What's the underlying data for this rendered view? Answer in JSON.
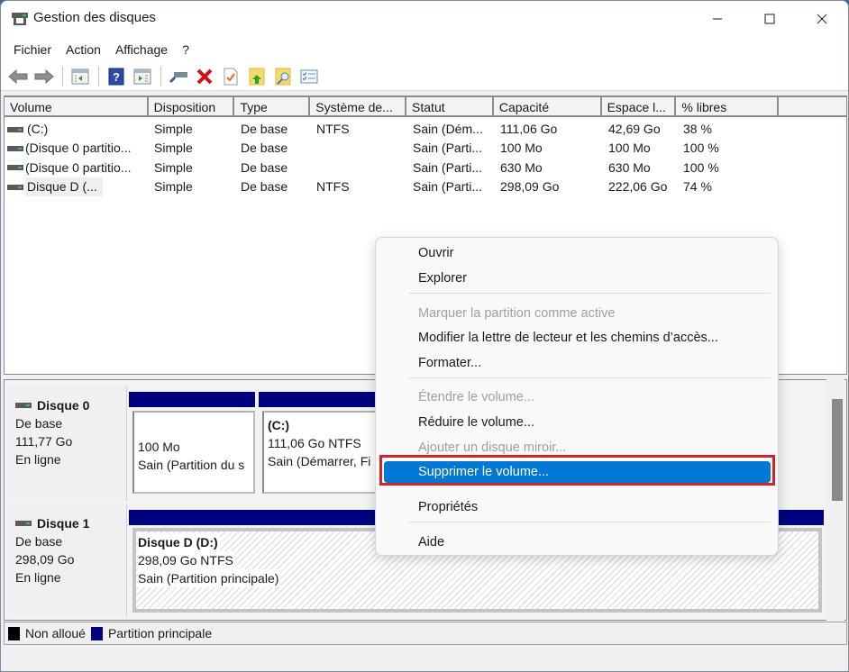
{
  "window": {
    "title": "Gestion des disques",
    "controls": [
      "minimize",
      "maximize",
      "close"
    ]
  },
  "menubar": {
    "items": [
      "Fichier",
      "Action",
      "Affichage",
      "?"
    ]
  },
  "toolbar": {
    "buttons": [
      "back-arrow-icon",
      "forward-arrow-icon",
      "show-hide-console-tree-icon",
      "help-icon",
      "show-hide-action-pane-icon",
      "connect-drive-icon",
      "delete-icon",
      "check-properties-icon",
      "folder-up-icon",
      "folder-search-icon",
      "list-settings-icon"
    ]
  },
  "volume_list": {
    "columns": [
      "Volume",
      "Disposition",
      "Type",
      "Système de...",
      "Statut",
      "Capacité",
      "Espace l...",
      "% libres"
    ],
    "rows": [
      {
        "volume": " (C:)",
        "disposition": "Simple",
        "type": "De base",
        "fs": "NTFS",
        "status": "Sain (Dém...",
        "capacity": "111,06 Go",
        "free": "42,69 Go",
        "pct": "38 %"
      },
      {
        "volume": "(Disque 0 partitio...",
        "disposition": "Simple",
        "type": "De base",
        "fs": "",
        "status": "Sain (Parti...",
        "capacity": "100 Mo",
        "free": "100 Mo",
        "pct": "100 %"
      },
      {
        "volume": "(Disque 0 partitio...",
        "disposition": "Simple",
        "type": "De base",
        "fs": "",
        "status": "Sain (Parti...",
        "capacity": "630 Mo",
        "free": "630 Mo",
        "pct": "100 %"
      },
      {
        "volume": "Disque D (...",
        "disposition": "Simple",
        "type": "De base",
        "fs": "NTFS",
        "status": "Sain (Parti...",
        "capacity": "298,09 Go",
        "free": "222,06 Go",
        "pct": "74 %"
      }
    ]
  },
  "disks": [
    {
      "name": "Disque 0",
      "type": "De base",
      "size": "111,77 Go",
      "state": "En ligne",
      "volumes": [
        {
          "title": "",
          "line1": "100 Mo",
          "line2": "Sain (Partition du s"
        },
        {
          "title": " (C:)",
          "line1": "111,06 Go NTFS",
          "line2": "Sain (Démarrer, Fi"
        }
      ]
    },
    {
      "name": "Disque 1",
      "type": "De base",
      "size": "298,09 Go",
      "state": "En ligne",
      "volumes": [
        {
          "title": "Disque D  (D:)",
          "line1": "298,09 Go NTFS",
          "line2": "Sain (Partition principale)"
        }
      ]
    }
  ],
  "legend": [
    {
      "label": "Non alloué",
      "color": "#000000"
    },
    {
      "label": "Partition principale",
      "color": "#000080"
    }
  ],
  "context_menu": {
    "items": [
      {
        "label": "Ouvrir",
        "state": "enabled"
      },
      {
        "label": "Explorer",
        "state": "enabled"
      },
      {
        "label": "Marquer la partition comme active",
        "state": "disabled"
      },
      {
        "label": "Modifier la lettre de lecteur et les chemins d’accès...",
        "state": "enabled"
      },
      {
        "label": "Formater...",
        "state": "enabled"
      },
      {
        "label": "Étendre le volume...",
        "state": "disabled"
      },
      {
        "label": "Réduire le volume...",
        "state": "enabled"
      },
      {
        "label": "Ajouter un disque miroir...",
        "state": "disabled"
      },
      {
        "label": "Supprimer le volume...",
        "state": "highlighted"
      },
      {
        "label": "Propriétés",
        "state": "enabled"
      },
      {
        "label": "Aide",
        "state": "enabled"
      }
    ]
  },
  "colors": {
    "highlight": "#0078d4",
    "partition_bar": "#000080",
    "callout_outline": "#d2232a"
  }
}
